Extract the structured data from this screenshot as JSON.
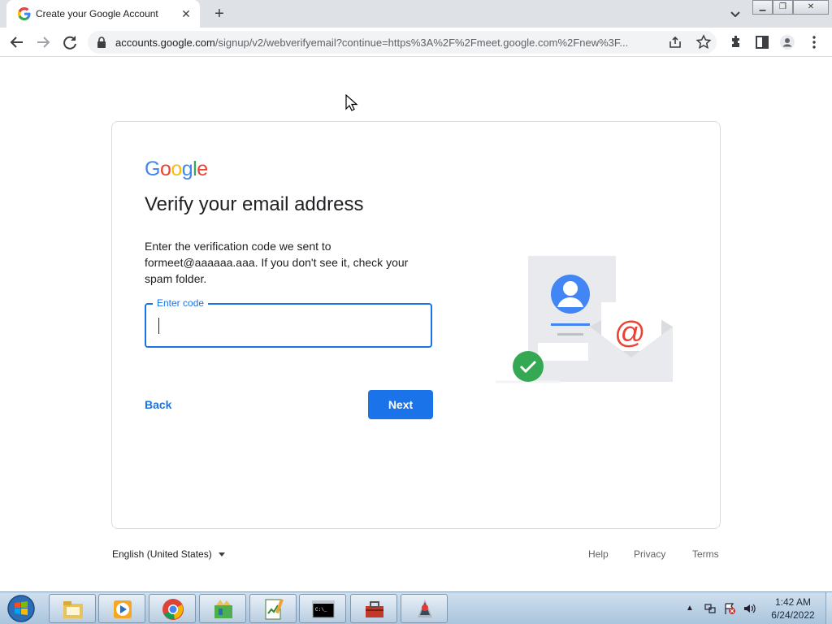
{
  "browser": {
    "tab_title": "Create your Google Account",
    "tab_close": "✕",
    "new_tab": "+",
    "url_host": "accounts.google.com",
    "url_path": "/signup/v2/webverifyemail?continue=https%3A%2F%2Fmeet.google.com%2Fnew%3F..."
  },
  "page": {
    "logo": [
      "G",
      "o",
      "o",
      "g",
      "l",
      "e"
    ],
    "logo_colors": [
      "#4285F4",
      "#EA4335",
      "#FBBC05",
      "#4285F4",
      "#34A853",
      "#EA4335"
    ],
    "heading": "Verify your email address",
    "description": "Enter the verification code we sent to formeet@aaaaaa.aaa. If you don't see it, check your spam folder.",
    "code_label": "Enter code",
    "code_value": "",
    "back_label": "Back",
    "next_label": "Next"
  },
  "footer": {
    "language": "English (United States)",
    "help": "Help",
    "privacy": "Privacy",
    "terms": "Terms"
  },
  "taskbar": {
    "time": "1:42 AM",
    "date": "6/24/2022",
    "items": [
      "file-explorer-icon",
      "media-player-icon",
      "chrome-icon",
      "app-icon",
      "notepad-icon",
      "command-prompt-icon",
      "toolbox-icon",
      "java-icon"
    ]
  },
  "colors": {
    "accent": "#1a73e8",
    "success": "#34a853"
  }
}
